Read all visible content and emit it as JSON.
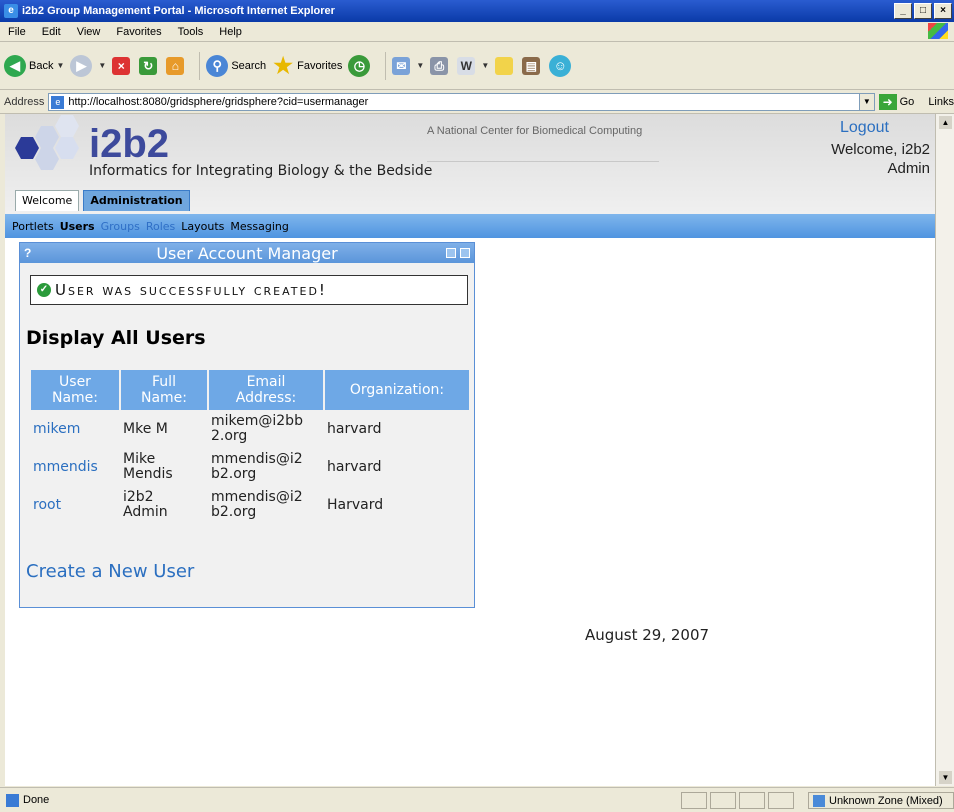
{
  "window": {
    "title": "i2b2 Group Management Portal - Microsoft Internet Explorer",
    "controls": [
      "_",
      "□",
      "×"
    ]
  },
  "menu": [
    "File",
    "Edit",
    "View",
    "Favorites",
    "Tools",
    "Help"
  ],
  "toolbar": {
    "back": "Back",
    "search": "Search",
    "favorites": "Favorites"
  },
  "address": {
    "label": "Address",
    "url": "http://localhost:8080/gridsphere/gridsphere?cid=usermanager",
    "go": "Go",
    "links": "Links"
  },
  "header": {
    "logo": "i2b2",
    "tagline": "Informatics for Integrating Biology & the Bedside",
    "ncbc": "A National Center for Biomedical Computing",
    "logout": "Logout",
    "welcome_line1": "Welcome, i2b2",
    "welcome_line2": "Admin"
  },
  "tabs": [
    "Welcome",
    "Administration"
  ],
  "subnav": [
    "Portlets",
    "Users",
    "Groups",
    "Roles",
    "Layouts",
    "Messaging"
  ],
  "portlet": {
    "help": "?",
    "title": "User Account Manager",
    "message": "User was successfully created!",
    "section_title": "Display All Users",
    "columns": [
      [
        "User",
        "Name:"
      ],
      [
        "Full",
        "Name:"
      ],
      [
        "Email",
        "Address:"
      ],
      [
        "Organization:"
      ]
    ],
    "rows": [
      {
        "user": "mikem",
        "full": [
          "Mke M"
        ],
        "email": [
          "mikem@i2bb",
          "2.org"
        ],
        "org": "harvard"
      },
      {
        "user": "mmendis",
        "full": [
          "Mike",
          "Mendis"
        ],
        "email": [
          "mmendis@i2",
          "b2.org"
        ],
        "org": "harvard"
      },
      {
        "user": "root",
        "full": [
          "i2b2",
          "Admin"
        ],
        "email": [
          "mmendis@i2",
          "b2.org"
        ],
        "org": "Harvard"
      }
    ],
    "create_link": "Create a New User"
  },
  "date": "August 29, 2007",
  "status": {
    "text": "Done",
    "zone": "Unknown Zone (Mixed)"
  }
}
